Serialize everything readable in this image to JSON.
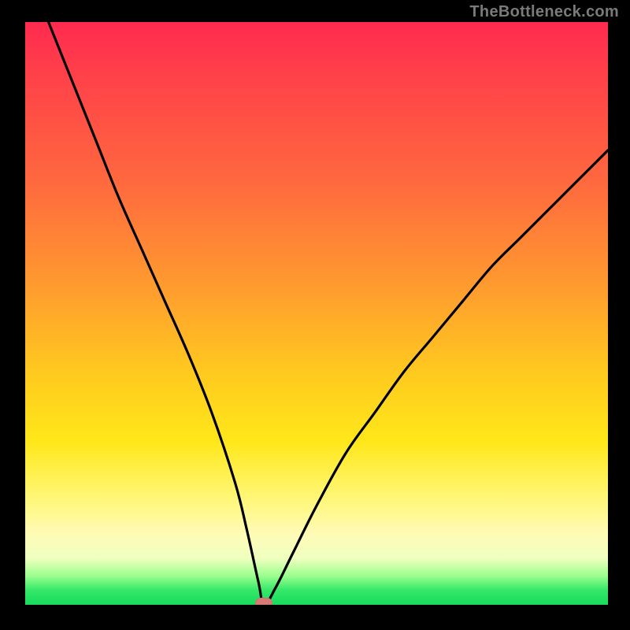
{
  "watermark": "TheBottleneck.com",
  "colors": {
    "background": "#000000",
    "curve": "#000000",
    "marker": "#d77a74",
    "gradient_top": "#ff2a4f",
    "gradient_bottom": "#18db5c"
  },
  "chart_data": {
    "type": "line",
    "title": "",
    "xlabel": "",
    "ylabel": "",
    "xlim": [
      0,
      100
    ],
    "ylim": [
      0,
      100
    ],
    "notes": "V-shaped bottleneck curve. Minimum (optimal point) at x≈41 where y≈0. Left branch rises steeply to y=100 at x≈4; right branch rises to y≈78 at x=100. Background is a vertical red→green gradient indicating bottleneck severity (red high, green low).",
    "series": [
      {
        "name": "bottleneck-curve",
        "x": [
          4,
          8,
          12,
          16,
          20,
          24,
          28,
          32,
          36,
          38,
          40,
          41,
          43,
          46,
          50,
          55,
          60,
          65,
          70,
          75,
          80,
          85,
          90,
          95,
          100
        ],
        "y": [
          100,
          90,
          80,
          70,
          61,
          52,
          43,
          33,
          21,
          13,
          4,
          0,
          3,
          9,
          17,
          26,
          33,
          40,
          46,
          52,
          58,
          63,
          68,
          73,
          78
        ]
      }
    ],
    "marker": {
      "x": 41,
      "y": 0
    },
    "gradient_stops": [
      {
        "pct": 0,
        "color": "#ff2a4f"
      },
      {
        "pct": 45,
        "color": "#ff9a2f"
      },
      {
        "pct": 72,
        "color": "#ffe71a"
      },
      {
        "pct": 95,
        "color": "#9cff8e"
      },
      {
        "pct": 100,
        "color": "#18db5c"
      }
    ]
  }
}
